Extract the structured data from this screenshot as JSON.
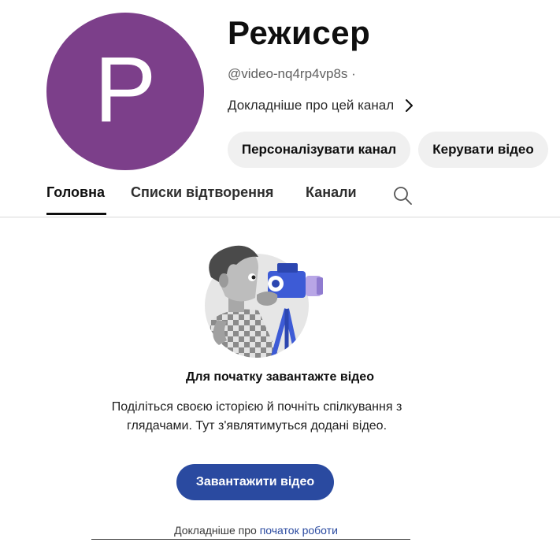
{
  "channel": {
    "avatar_letter": "P",
    "avatar_color": "#7c3f8a",
    "name": "Режисер",
    "handle": "@video-nq4rp4vp8s ·",
    "about_link": "Докладніше про цей канал"
  },
  "actions": {
    "customize_label": "Персоналізувати канал",
    "manage_label": "Керувати відео"
  },
  "tabs": {
    "items": [
      {
        "label": "Головна",
        "active": true
      },
      {
        "label": "Списки відтворення",
        "active": false
      },
      {
        "label": "Канали",
        "active": false
      }
    ],
    "search_icon": "search-icon"
  },
  "empty_state": {
    "illustration": "camera-operator-illustration",
    "title": "Для початку завантажте відео",
    "description": "Поділіться своєю історією й почніть спілкування з глядачами. Тут з'являтимуться додані відео.",
    "upload_button": "Завантажити відео",
    "learn_more_prefix": "Докладніше про",
    "learn_more_link": "початок роботи"
  },
  "colors": {
    "accent": "#2a4aa0",
    "button_bg": "#f0f0f0"
  }
}
